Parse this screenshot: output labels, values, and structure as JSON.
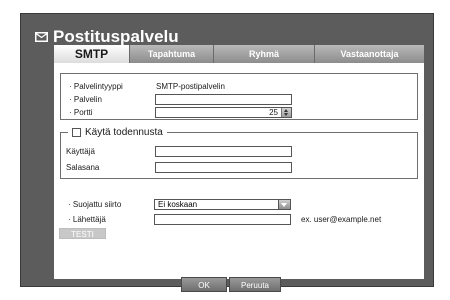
{
  "window": {
    "title": "Postituspalvelu"
  },
  "tabs": [
    {
      "label": "SMTP",
      "active": true
    },
    {
      "label": "Tapahtuma",
      "active": false
    },
    {
      "label": "Ryhmä",
      "active": false
    },
    {
      "label": "Vastaanottaja",
      "active": false
    }
  ],
  "server": {
    "type_label": "· Palvelintyyppi",
    "type_value": "SMTP-postipalvelin",
    "server_label": "· Palvelin",
    "server_value": "",
    "port_label": "· Portti",
    "port_value": "25"
  },
  "auth": {
    "checkbox_label": "Käytä todennusta",
    "checked": false,
    "user_label": "Käyttäjä",
    "user_value": "",
    "password_label": "Salasana",
    "password_value": ""
  },
  "security": {
    "secure_label": "· Suojattu siirto",
    "secure_value": "Ei koskaan",
    "sender_label": "· Lähettäjä",
    "sender_value": "",
    "sender_hint": "ex. user@example.net",
    "test_label": "TESTI"
  },
  "footer": {
    "ok_label": "OK",
    "cancel_label": "Peruuta"
  },
  "colors": {
    "background": "#5c5c5c",
    "panel": "#ffffff",
    "tab_active": "#f0f0f0",
    "tab_inactive": "#a8a8a8"
  }
}
